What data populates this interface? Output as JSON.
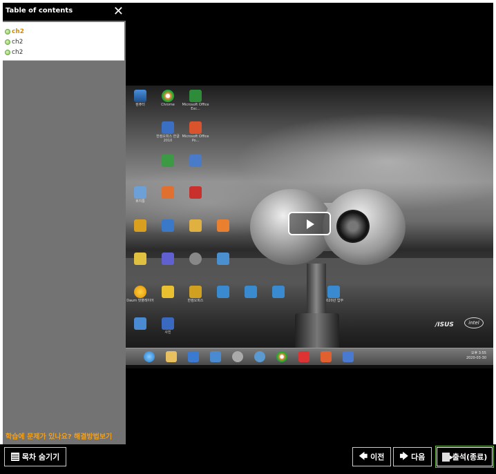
{
  "toc": {
    "title": "Table of contents",
    "close": "✕",
    "items": [
      {
        "label": "ch2",
        "active": true
      },
      {
        "label": "ch2",
        "active": false
      },
      {
        "label": "ch2",
        "active": false
      }
    ],
    "help_link": "학습에 문제가 있나요? 해결방법보기"
  },
  "player": {
    "state": "paused",
    "brand_text": "/ISUS",
    "intel_text": "intel",
    "tray_time": "오후 3:55\n2020-03-30",
    "desktop_labels": [
      "컴퓨터",
      "Chrome",
      "Microsoft Office Exc...",
      "한컴오피스 한글 2010",
      "Microsoft Office Po...",
      "휴지통",
      "Daum 팟플레이어",
      "한컴오피스",
      "사진",
      "2020년 업무"
    ]
  },
  "bottom": {
    "hide_toc": "목차 숨기기",
    "prev": "이전",
    "next": "다음",
    "exit": "출석(종료)"
  },
  "colors": {
    "accent": "#6cbf3a",
    "active_item": "#d88a00",
    "help_link": "#f0a020",
    "sidebar_bg": "#737373"
  }
}
